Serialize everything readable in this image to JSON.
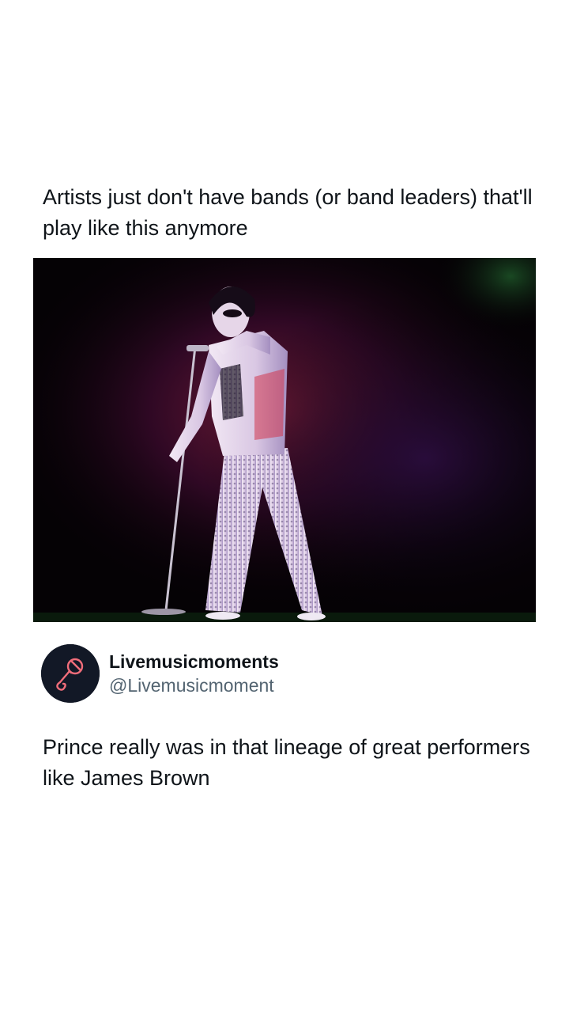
{
  "post": {
    "caption": "Artists just don't have bands (or band leaders) that'll play like this anymore",
    "media": {
      "icon": "concert-performer-image",
      "alt_colors": {
        "background": "#050205",
        "spotlight": "#6b1e5a",
        "suit": "#e9dcef",
        "suit_shadow": "#a48fc0"
      }
    }
  },
  "embedded_tweet": {
    "avatar_icon": "microphone-icon",
    "display_name": "Livemusicmoments",
    "handle": "@Livemusicmoment",
    "text": "Prince really was in that lineage of great performers like James Brown"
  },
  "colors": {
    "text_primary": "#0f1419",
    "text_secondary": "#536471",
    "avatar_bg": "#121826",
    "avatar_accent": "#f06d7a"
  }
}
